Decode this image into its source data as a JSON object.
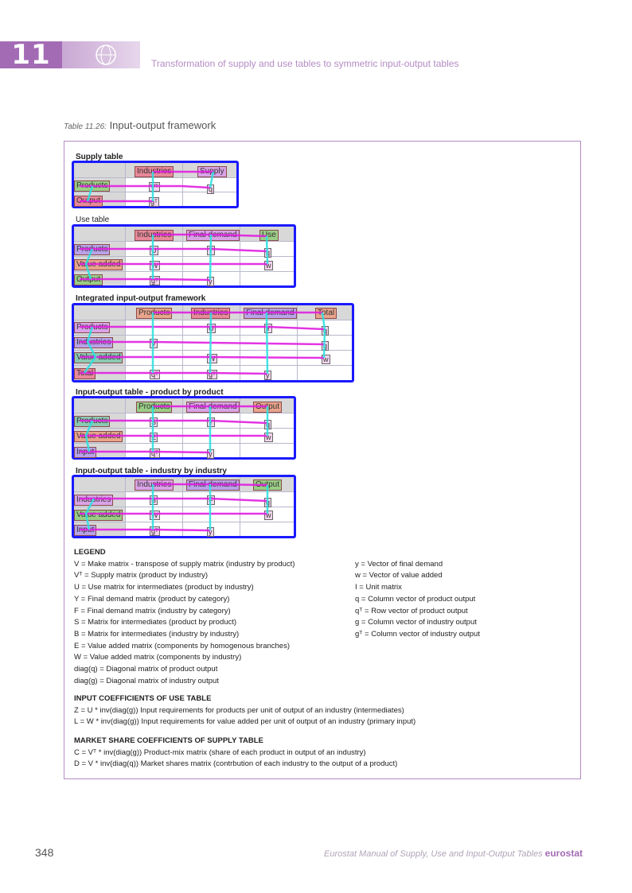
{
  "header": {
    "chapter_number": "11",
    "chapter_title": "Transformation of supply and use tables to symmetric input-output tables"
  },
  "caption": {
    "label": "Table 11.26:",
    "title": "Input-output framework"
  },
  "tables": {
    "supply": {
      "title": "Supply table",
      "cols": [
        "Industries",
        "Supply"
      ],
      "rows": [
        "Products",
        "Output"
      ],
      "cells": [
        [
          "Vᵀ",
          "q"
        ],
        [
          "gᵀ",
          ""
        ]
      ]
    },
    "use": {
      "title": "Use table",
      "cols": [
        "Industries",
        "Final demand",
        "Use"
      ],
      "rows": [
        "Products",
        "Value added",
        "Output"
      ],
      "cells": [
        [
          "U",
          "Y",
          "q"
        ],
        [
          "W",
          "",
          "w"
        ],
        [
          "gᵀ",
          "y",
          ""
        ]
      ]
    },
    "integrated": {
      "title": "Integrated input-output framework",
      "cols": [
        "Products",
        "Industries",
        "Final demand",
        "Total"
      ],
      "rows": [
        "Products",
        "Industries",
        "Value added",
        "Total"
      ],
      "cells": [
        [
          "",
          "U",
          "Y",
          "q"
        ],
        [
          "V",
          "",
          "",
          "g"
        ],
        [
          "",
          "W",
          "",
          "w"
        ],
        [
          "qᵀ",
          "gᵀ",
          "y",
          ""
        ]
      ]
    },
    "pxp": {
      "title": "Input-output table - product by product",
      "cols": [
        "Products",
        "Final demand",
        "Output"
      ],
      "rows": [
        "Products",
        "Value added",
        "Input"
      ],
      "cells": [
        [
          "S",
          "Y",
          "q"
        ],
        [
          "E",
          "",
          "w"
        ],
        [
          "qᵀ",
          "y",
          ""
        ]
      ]
    },
    "ixi": {
      "title": "Input-output table - industry by industry",
      "cols": [
        "Industries",
        "Final demand",
        "Output"
      ],
      "rows": [
        "Industries",
        "Value added",
        "Input"
      ],
      "cells": [
        [
          "B",
          "F",
          "g"
        ],
        [
          "W",
          "",
          "w"
        ],
        [
          "gᵀ",
          "y",
          ""
        ]
      ]
    }
  },
  "legend": {
    "title": "LEGEND",
    "left": [
      "V = Make matrix - transpose of supply matrix (industry by product)",
      "Vᵀ = Supply matrix (product by industry)",
      "U = Use matrix for intermediates (product by industry)",
      "Y = Final demand matrix (product by category)",
      "F = Final demand matrix (industry by category)",
      "S = Matrix for intermediates (product by product)",
      "B = Matrix for intermediates (industry by industry)",
      "E = Value added matrix (components by homogenous branches)",
      "W = Value added matrix (components by industry)",
      "diag(q) = Diagonal matrix of product output",
      "diag(g) = Diagonal matrix of industry output"
    ],
    "right": [
      "y = Vector of final demand",
      "w = Vector of value added",
      "I = Unit matrix",
      "q = Column vector of product output",
      "qᵀ = Row vector of product output",
      "g = Column vector of industry output",
      "gᵀ = Column vector of industry output"
    ]
  },
  "input_coefficients": {
    "title": "INPUT COEFFICIENTS OF USE TABLE",
    "lines": [
      "Z = U * inv(diag(g)) Input requirements for products per unit of output of an industry (intermediates)",
      "L = W * inv(diag(g)) Input requirements for value added per unit of output of an industry (primary input)"
    ]
  },
  "market_share": {
    "title": "MARKET SHARE COEFFICIENTS OF SUPPLY TABLE",
    "lines": [
      "C = Vᵀ * inv(diag(g)) Product-mix matrix (share of each product in output of an industry)",
      "D = V * inv(diag(q)) Market shares matrix (contrbution of each industry to the output of a product)"
    ]
  },
  "footer": {
    "page_number": "348",
    "publication": "Eurostat Manual of Supply, Use and Input-Output Tables",
    "brand": "eurostat"
  },
  "colors": {
    "accent": "#a46bb5",
    "table_border": "#1a1aff",
    "connector_magenta": "#e020e0",
    "connector_cyan": "#30e0e0"
  }
}
